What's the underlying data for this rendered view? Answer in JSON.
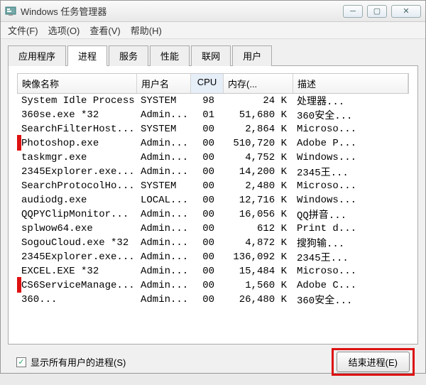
{
  "window": {
    "title": "Windows 任务管理器"
  },
  "menu": {
    "file": "文件(F)",
    "options": "选项(O)",
    "view": "查看(V)",
    "help": "帮助(H)"
  },
  "tabs": [
    {
      "label": "应用程序"
    },
    {
      "label": "进程"
    },
    {
      "label": "服务"
    },
    {
      "label": "性能"
    },
    {
      "label": "联网"
    },
    {
      "label": "用户"
    }
  ],
  "columns": {
    "image": "映像名称",
    "user": "用户名",
    "cpu": "CPU",
    "mem": "内存(...",
    "desc": "描述"
  },
  "rows": [
    {
      "name": "System Idle Process",
      "user": "SYSTEM",
      "cpu": "98",
      "mem": "24 K",
      "desc": "处理器..."
    },
    {
      "name": "360se.exe *32",
      "user": "Admin...",
      "cpu": "01",
      "mem": "51,680 K",
      "desc": "360安全..."
    },
    {
      "name": "SearchFilterHost...",
      "user": "SYSTEM",
      "cpu": "00",
      "mem": "2,864 K",
      "desc": "Microso..."
    },
    {
      "name": "Photoshop.exe",
      "user": "Admin...",
      "cpu": "00",
      "mem": "510,720 K",
      "desc": "Adobe P..."
    },
    {
      "name": "taskmgr.exe",
      "user": "Admin...",
      "cpu": "00",
      "mem": "4,752 K",
      "desc": "Windows..."
    },
    {
      "name": "2345Explorer.exe...",
      "user": "Admin...",
      "cpu": "00",
      "mem": "14,200 K",
      "desc": "2345王..."
    },
    {
      "name": "SearchProtocolHo...",
      "user": "SYSTEM",
      "cpu": "00",
      "mem": "2,480 K",
      "desc": "Microso..."
    },
    {
      "name": "audiodg.exe",
      "user": "LOCAL...",
      "cpu": "00",
      "mem": "12,716 K",
      "desc": "Windows..."
    },
    {
      "name": "QQPYClipMonitor...",
      "user": "Admin...",
      "cpu": "00",
      "mem": "16,056 K",
      "desc": "QQ拼音..."
    },
    {
      "name": "splwow64.exe",
      "user": "Admin...",
      "cpu": "00",
      "mem": "612 K",
      "desc": "Print d..."
    },
    {
      "name": "SogouCloud.exe *32",
      "user": "Admin...",
      "cpu": "00",
      "mem": "4,872 K",
      "desc": "搜狗输..."
    },
    {
      "name": "2345Explorer.exe...",
      "user": "Admin...",
      "cpu": "00",
      "mem": "136,092 K",
      "desc": "2345王..."
    },
    {
      "name": "EXCEL.EXE *32",
      "user": "Admin...",
      "cpu": "00",
      "mem": "15,484 K",
      "desc": "Microso..."
    },
    {
      "name": "CS6ServiceManage...",
      "user": "Admin...",
      "cpu": "00",
      "mem": "1,560 K",
      "desc": "Adobe C..."
    },
    {
      "name": "360...",
      "user": "Admin...",
      "cpu": "00",
      "mem": "26,480 K",
      "desc": "360安全..."
    }
  ],
  "footer": {
    "show_all": "显示所有用户的进程(S)",
    "end_process": "结束进程(E)"
  },
  "highlight": {
    "row1_index": 3,
    "row2_index": 13,
    "color": "#d11"
  }
}
